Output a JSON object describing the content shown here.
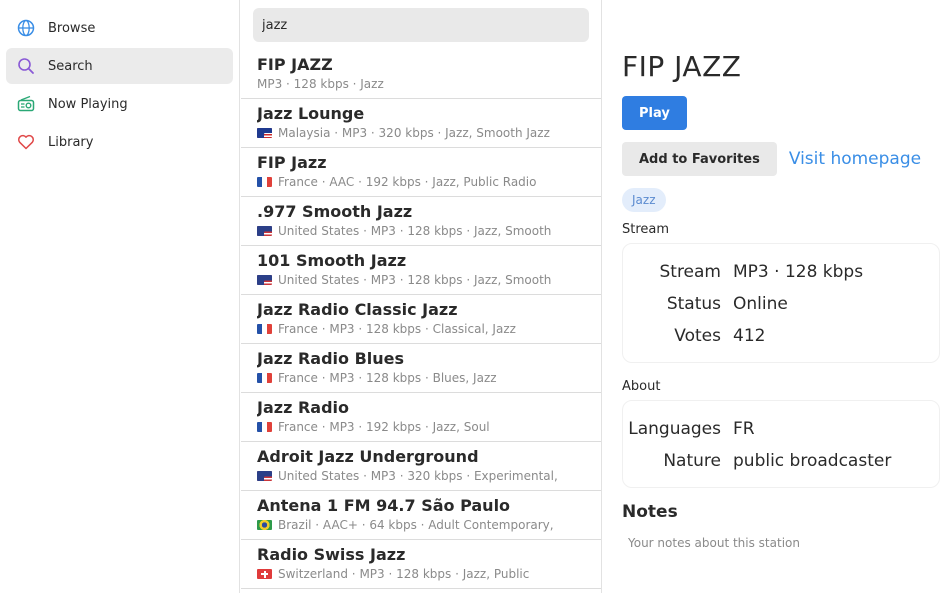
{
  "sidebar": {
    "items": [
      {
        "label": "Browse",
        "icon": "globe-icon",
        "active": false
      },
      {
        "label": "Search",
        "icon": "search-icon",
        "active": true
      },
      {
        "label": "Now Playing",
        "icon": "radio-icon",
        "active": false
      },
      {
        "label": "Library",
        "icon": "heart-icon",
        "active": false
      }
    ]
  },
  "search": {
    "value": "jazz"
  },
  "stations": [
    {
      "name": "FIP JAZZ",
      "flag": "",
      "meta": "MP3 · 128 kbps · Jazz"
    },
    {
      "name": "Jazz Lounge",
      "flag": "malaysia-flag-icon",
      "meta": "Malaysia · MP3 · 320 kbps · Jazz, Smooth Jazz"
    },
    {
      "name": "FIP Jazz",
      "flag": "france-flag-icon",
      "meta": "France · AAC · 192 kbps · Jazz, Public Radio"
    },
    {
      "name": ".977 Smooth Jazz",
      "flag": "us-flag-icon",
      "meta": "United States · MP3 · 128 kbps · Jazz, Smooth"
    },
    {
      "name": "101 Smooth Jazz",
      "flag": "us-flag-icon",
      "meta": "United States · MP3 · 128 kbps · Jazz, Smooth"
    },
    {
      "name": "Jazz Radio Classic Jazz",
      "flag": "france-flag-icon",
      "meta": "France · MP3 · 128 kbps · Classical, Jazz"
    },
    {
      "name": "Jazz Radio Blues",
      "flag": "france-flag-icon",
      "meta": "France · MP3 · 128 kbps · Blues, Jazz"
    },
    {
      "name": "Jazz Radio",
      "flag": "france-flag-icon",
      "meta": "France · MP3 · 192 kbps · Jazz, Soul"
    },
    {
      "name": "Adroit Jazz Underground",
      "flag": "us-flag-icon",
      "meta": "United States · MP3 · 320 kbps · Experimental,"
    },
    {
      "name": "Antena 1 FM 94.7 São Paulo",
      "flag": "brazil-flag-icon",
      "meta": "Brazil · AAC+ · 64 kbps · Adult Contemporary,"
    },
    {
      "name": "Radio Swiss Jazz",
      "flag": "switzerland-flag-icon",
      "meta": "Switzerland · MP3 · 128 kbps · Jazz, Public"
    }
  ],
  "detail": {
    "title": "FIP JAZZ",
    "play_label": "Play",
    "favorites_label": "Add to Favorites",
    "homepage_label": "Visit homepage",
    "tag": "Jazz",
    "stream_section": "Stream",
    "stream_rows": [
      {
        "key": "Stream",
        "value": "MP3 · 128 kbps"
      },
      {
        "key": "Status",
        "value": "Online"
      },
      {
        "key": "Votes",
        "value": "412"
      }
    ],
    "about_section": "About",
    "about_rows": [
      {
        "key": "Languages",
        "value": "FR"
      },
      {
        "key": "Nature",
        "value": "public broadcaster"
      }
    ],
    "notes_title": "Notes",
    "notes_placeholder": "Your notes about this station"
  },
  "colors": {
    "accent": "#2f7de1",
    "link": "#3a8ee6",
    "tag_bg": "#e3edfb",
    "tag_text": "#5b8bd0"
  }
}
